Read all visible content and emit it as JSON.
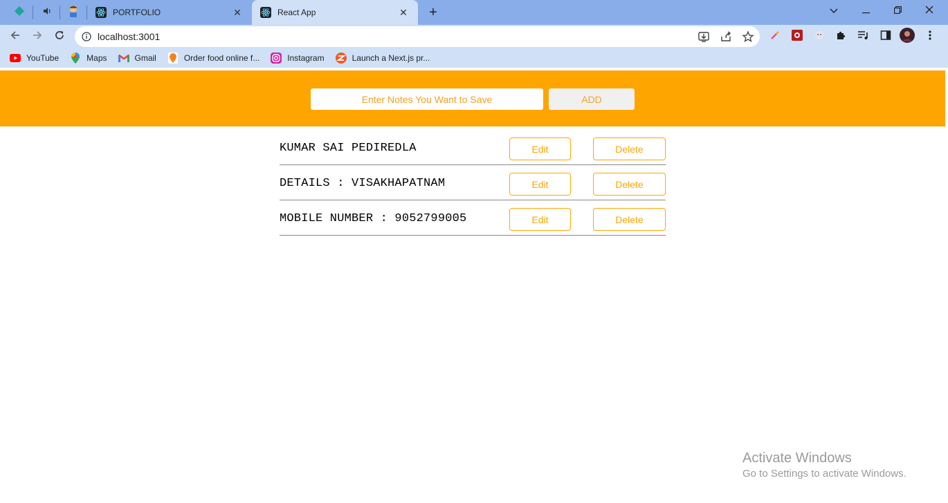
{
  "browser": {
    "tabs": [
      {
        "title": "PORTFOLIO",
        "icon": "react-icon",
        "active": false
      },
      {
        "title": "React App",
        "icon": "react-icon",
        "active": true
      }
    ],
    "pinned_tabs": [
      "diamond-app-icon",
      "speaker-icon",
      "avatar-icon"
    ],
    "new_tab_label": "+",
    "url": "localhost:3001",
    "bookmarks": [
      {
        "label": "YouTube",
        "icon": "youtube-icon"
      },
      {
        "label": "Maps",
        "icon": "maps-icon"
      },
      {
        "label": "Gmail",
        "icon": "gmail-icon"
      },
      {
        "label": "Order food online f...",
        "icon": "swiggy-icon"
      },
      {
        "label": "Instagram",
        "icon": "instagram-icon"
      },
      {
        "label": "Launch a Next.js pr...",
        "icon": "zeet-icon"
      }
    ]
  },
  "app": {
    "header_color": "#ffa500",
    "input_placeholder": "Enter Notes You Want to Save",
    "add_label": "ADD",
    "notes": [
      {
        "text": "KUMAR SAI PEDIREDLA",
        "edit_label": "Edit",
        "delete_label": "Delete"
      },
      {
        "text": "DETAILS : VISAKHAPATNAM",
        "edit_label": "Edit",
        "delete_label": "Delete"
      },
      {
        "text": "MOBILE NUMBER : 9052799005",
        "edit_label": "Edit",
        "delete_label": "Delete"
      }
    ]
  },
  "watermark": {
    "title": "Activate Windows",
    "subtitle": "Go to Settings to activate Windows."
  }
}
